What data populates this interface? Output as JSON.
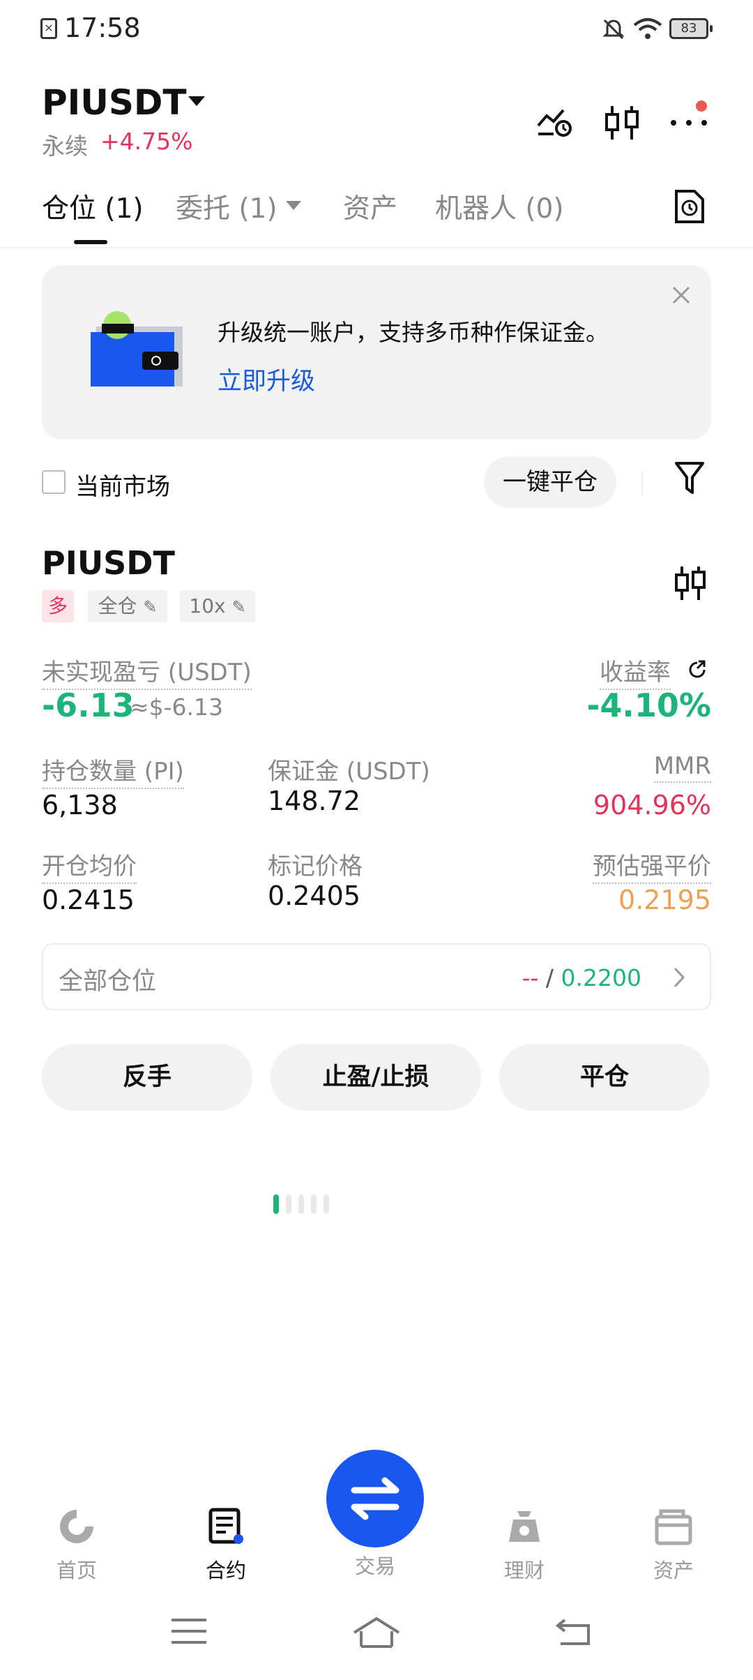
{
  "status_bar": {
    "time": "17:58",
    "battery": "83"
  },
  "header": {
    "pair": "PIUSDT",
    "type": "永续",
    "change": "+4.75%"
  },
  "tabs": [
    {
      "label": "仓位 (1)"
    },
    {
      "label": "委托 (1)"
    },
    {
      "label": "资产"
    },
    {
      "label": "机器人 (0)"
    }
  ],
  "banner": {
    "text": "升级统一账户，支持多币种作保证金。",
    "link": "立即升级"
  },
  "filter": {
    "current_market": "当前市场",
    "close_all": "一键平仓"
  },
  "position": {
    "symbol": "PIUSDT",
    "side": "多",
    "margin_mode": "全仓",
    "leverage": "10x",
    "risk_level_fraction": 0.2,
    "unrealized_pnl_label": "未实现盈亏 (USDT)",
    "unrealized_pnl": "-6.13",
    "unrealized_pnl_approx": "≈$-6.13",
    "roe_label": "收益率",
    "roe": "-4.10%",
    "size_label": "持仓数量 (PI)",
    "size": "6,138",
    "margin_label": "保证金 (USDT)",
    "margin": "148.72",
    "mmr_label": "MMR",
    "mmr": "904.96%",
    "entry_label": "开仓均价",
    "entry": "0.2415",
    "mark_label": "标记价格",
    "mark": "0.2405",
    "liq_label": "预估强平价",
    "liq": "0.2195",
    "all_positions_label": "全部仓位",
    "tp_value": "--",
    "slash": " / ",
    "sl_value": "0.2200"
  },
  "actions": {
    "reverse": "反手",
    "tpsl": "止盈/止损",
    "close": "平仓"
  },
  "bottom_nav": [
    {
      "label": "首页",
      "icon": "home-icon"
    },
    {
      "label": "合约",
      "icon": "futures-icon"
    },
    {
      "label": "交易",
      "icon": "trade-swap-icon"
    },
    {
      "label": "理财",
      "icon": "earn-icon"
    },
    {
      "label": "资产",
      "icon": "assets-icon"
    }
  ],
  "colors": {
    "accent": "#1a56f0",
    "up": "#e2335b",
    "down": "#1db47a",
    "warn": "#f0a052"
  }
}
